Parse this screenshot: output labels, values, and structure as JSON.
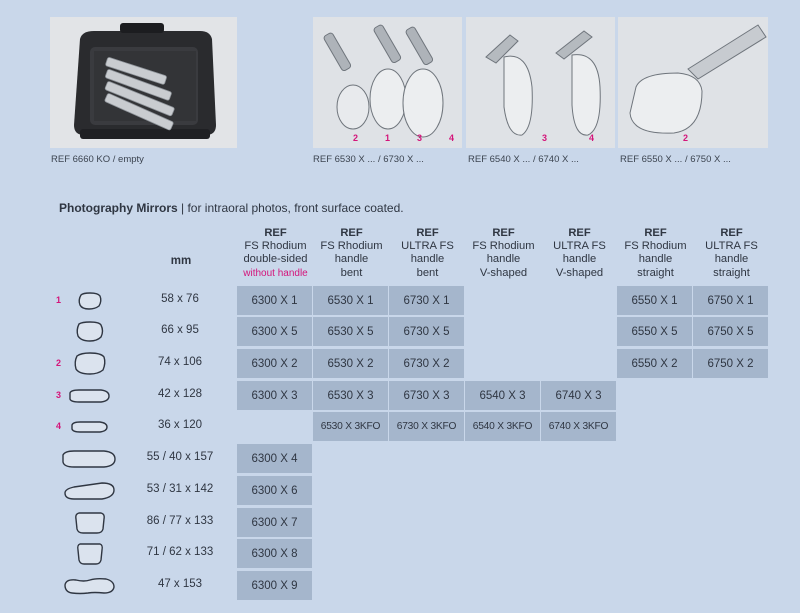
{
  "photos": [
    {
      "caption": "REF 6660 KO / empty",
      "numbers": []
    },
    {
      "caption": "REF 6530 X ... / 6730 X ...",
      "numbers": [
        "2",
        "1",
        "3",
        "4"
      ]
    },
    {
      "caption": "REF 6540 X ... / 6740 X ...",
      "numbers": [
        "3",
        "4"
      ]
    },
    {
      "caption": "REF 6550 X ... / 6750 X ...",
      "numbers": [
        "2"
      ]
    }
  ],
  "section": {
    "title": "Photography Mirrors",
    "subtitle": " | for intraoral photos, front surface coated."
  },
  "table": {
    "mm_header": "mm",
    "columns": [
      {
        "ref": "REF",
        "lines": [
          "FS Rhodium",
          "double-sided"
        ],
        "pink": "without handle"
      },
      {
        "ref": "REF",
        "lines": [
          "FS Rhodium",
          "handle",
          "bent"
        ],
        "pink": ""
      },
      {
        "ref": "REF",
        "lines": [
          "ULTRA FS",
          "handle",
          "bent"
        ],
        "pink": ""
      },
      {
        "ref": "REF",
        "lines": [
          "FS Rhodium",
          "handle",
          "V-shaped"
        ],
        "pink": ""
      },
      {
        "ref": "REF",
        "lines": [
          "ULTRA FS",
          "handle",
          "V-shaped"
        ],
        "pink": ""
      },
      {
        "ref": "REF",
        "lines": [
          "FS Rhodium",
          "handle",
          "straight"
        ],
        "pink": ""
      },
      {
        "ref": "REF",
        "lines": [
          "ULTRA FS",
          "handle",
          "straight"
        ],
        "pink": ""
      }
    ],
    "rows": [
      {
        "num": "1",
        "size": "58 x 76",
        "shape": "oval-small",
        "cells": [
          "6300 X 1",
          "6530 X 1",
          "6730 X 1",
          "",
          "",
          "6550 X 1",
          "6750 X 1"
        ]
      },
      {
        "num": "",
        "size": "66 x 95",
        "shape": "oval-medium",
        "cells": [
          "6300 X 5",
          "6530 X 5",
          "6730 X 5",
          "",
          "",
          "6550 X 5",
          "6750 X 5"
        ]
      },
      {
        "num": "2",
        "size": "74 x 106",
        "shape": "oval-large",
        "cells": [
          "6300 X 2",
          "6530 X 2",
          "6730 X 2",
          "",
          "",
          "6550 X 2",
          "6750 X 2"
        ]
      },
      {
        "num": "3",
        "size": "42 x 128",
        "shape": "elongated",
        "cells": [
          "6300 X 3",
          "6530 X 3",
          "6730 X 3",
          "6540 X 3",
          "6740 X 3",
          "",
          ""
        ]
      },
      {
        "num": "4",
        "size": "36 x 120",
        "shape": "elongated-thin",
        "cells": [
          "",
          "6530 X 3KFO",
          "6730 X 3KFO",
          "6540 X 3KFO",
          "6740 X 3KFO",
          "",
          ""
        ]
      },
      {
        "num": "",
        "size": "55 / 40 x 157",
        "shape": "buccal-wide",
        "cells": [
          "6300 X 4",
          "",
          "",
          "",
          "",
          "",
          ""
        ]
      },
      {
        "num": "",
        "size": "53 / 31 x 142",
        "shape": "buccal-tapered",
        "cells": [
          "6300 X 6",
          "",
          "",
          "",
          "",
          "",
          ""
        ]
      },
      {
        "num": "",
        "size": "86 / 77 x 133",
        "shape": "occlusal-large",
        "cells": [
          "6300 X 7",
          "",
          "",
          "",
          "",
          "",
          ""
        ]
      },
      {
        "num": "",
        "size": "71 / 62 x 133",
        "shape": "occlusal-medium",
        "cells": [
          "6300 X 8",
          "",
          "",
          "",
          "",
          "",
          ""
        ]
      },
      {
        "num": "",
        "size": "47 x 153",
        "shape": "lingual",
        "cells": [
          "6300 X 9",
          "",
          "",
          "",
          "",
          "",
          ""
        ]
      }
    ]
  }
}
